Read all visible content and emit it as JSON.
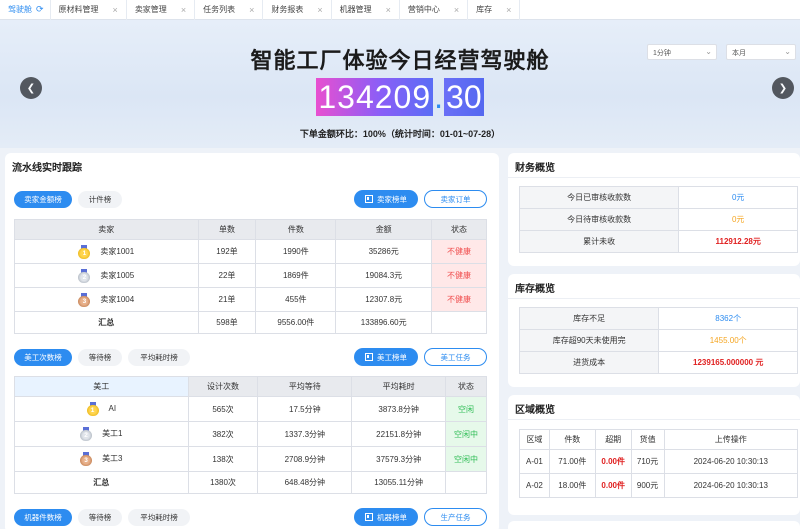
{
  "tabs": [
    {
      "label": "驾驶舱",
      "icon": "refresh-icon",
      "active": true
    },
    {
      "label": "原材料管理"
    },
    {
      "label": "卖家管理"
    },
    {
      "label": "任务列表"
    },
    {
      "label": "财务报表"
    },
    {
      "label": "机器管理"
    },
    {
      "label": "营销中心"
    },
    {
      "label": "库存"
    }
  ],
  "banner": {
    "title": "智能工厂体验今日经营驾驶舱",
    "interval_select": "1分钟",
    "period_select": "本月",
    "amount_int": "134209",
    "amount_dec": "30",
    "ratio_text": "下单金额环比：100%（统计时间：01-01~07-28）"
  },
  "pipeline": {
    "title": "流水线实时跟踪",
    "seller_section": {
      "toggles": [
        "卖家金额榜",
        "计件榜"
      ],
      "rank_button": "卖家榜单",
      "order_button": "卖家订单",
      "headers": [
        "卖家",
        "单数",
        "件数",
        "金额",
        "状态"
      ],
      "rows": [
        {
          "rank": "1",
          "name": "卖家1001",
          "orders": "192单",
          "pieces": "1990件",
          "amount": "35286元",
          "status": "不健康"
        },
        {
          "rank": "2",
          "name": "卖家1005",
          "orders": "22单",
          "pieces": "1869件",
          "amount": "19084.3元",
          "status": "不健康"
        },
        {
          "rank": "3",
          "name": "卖家1004",
          "orders": "21单",
          "pieces": "455件",
          "amount": "12307.8元",
          "status": "不健康"
        }
      ],
      "total": {
        "label": "汇总",
        "orders": "598单",
        "pieces": "9556.00件",
        "amount": "133896.60元"
      }
    },
    "designer_section": {
      "toggles": [
        "美工次数榜",
        "等待榜",
        "平均耗时榜"
      ],
      "rank_button": "美工榜单",
      "task_button": "美工任务",
      "headers": [
        "美工",
        "设计次数",
        "平均等待",
        "平均耗时",
        "状态"
      ],
      "rows": [
        {
          "rank": "1",
          "name": "AI",
          "count": "565次",
          "wait": "17.5分钟",
          "time": "3873.8分钟",
          "status": "空闲"
        },
        {
          "rank": "2",
          "name": "美工1",
          "count": "382次",
          "wait": "1337.3分钟",
          "time": "22151.8分钟",
          "status": "空闲中"
        },
        {
          "rank": "3",
          "name": "美工3",
          "count": "138次",
          "wait": "2708.9分钟",
          "time": "37579.3分钟",
          "status": "空闲中"
        }
      ],
      "total": {
        "label": "汇总",
        "count": "1380次",
        "wait": "648.48分钟",
        "time": "13055.11分钟"
      }
    },
    "machine_section": {
      "toggles": [
        "机器件数榜",
        "等待榜",
        "平均耗时榜"
      ],
      "rank_button": "机器榜单",
      "task_button": "生产任务"
    }
  },
  "finance": {
    "title": "财务概览",
    "rows": [
      {
        "label": "今日已审核收款数",
        "value": "0元",
        "color": "#2d8cf0"
      },
      {
        "label": "今日待审核收款数",
        "value": "0元",
        "color": "#f5a623"
      },
      {
        "label": "累计未收",
        "value": "112912.28元",
        "color": "#e02020"
      }
    ]
  },
  "inventory": {
    "title": "库存概览",
    "rows": [
      {
        "label": "库存不足",
        "value": "8362个",
        "color": "#2d8cf0"
      },
      {
        "label": "库存超90天未使用完",
        "value": "1455.00个",
        "color": "#f5a623"
      },
      {
        "label": "进货成本",
        "value": "1239165.000000 元",
        "color": "#e02020"
      }
    ]
  },
  "region": {
    "title": "区域概览",
    "headers": [
      "区域",
      "件数",
      "超期",
      "货值",
      "上传操作"
    ],
    "rows": [
      {
        "area": "A-01",
        "count": "71.00件",
        "overdue": "0.00件",
        "value": "710元",
        "upload": "2024-06-20 10:30:13"
      },
      {
        "area": "A-02",
        "count": "18.00件",
        "overdue": "0.00件",
        "value": "900元",
        "upload": "2024-06-20 10:30:13"
      }
    ]
  }
}
